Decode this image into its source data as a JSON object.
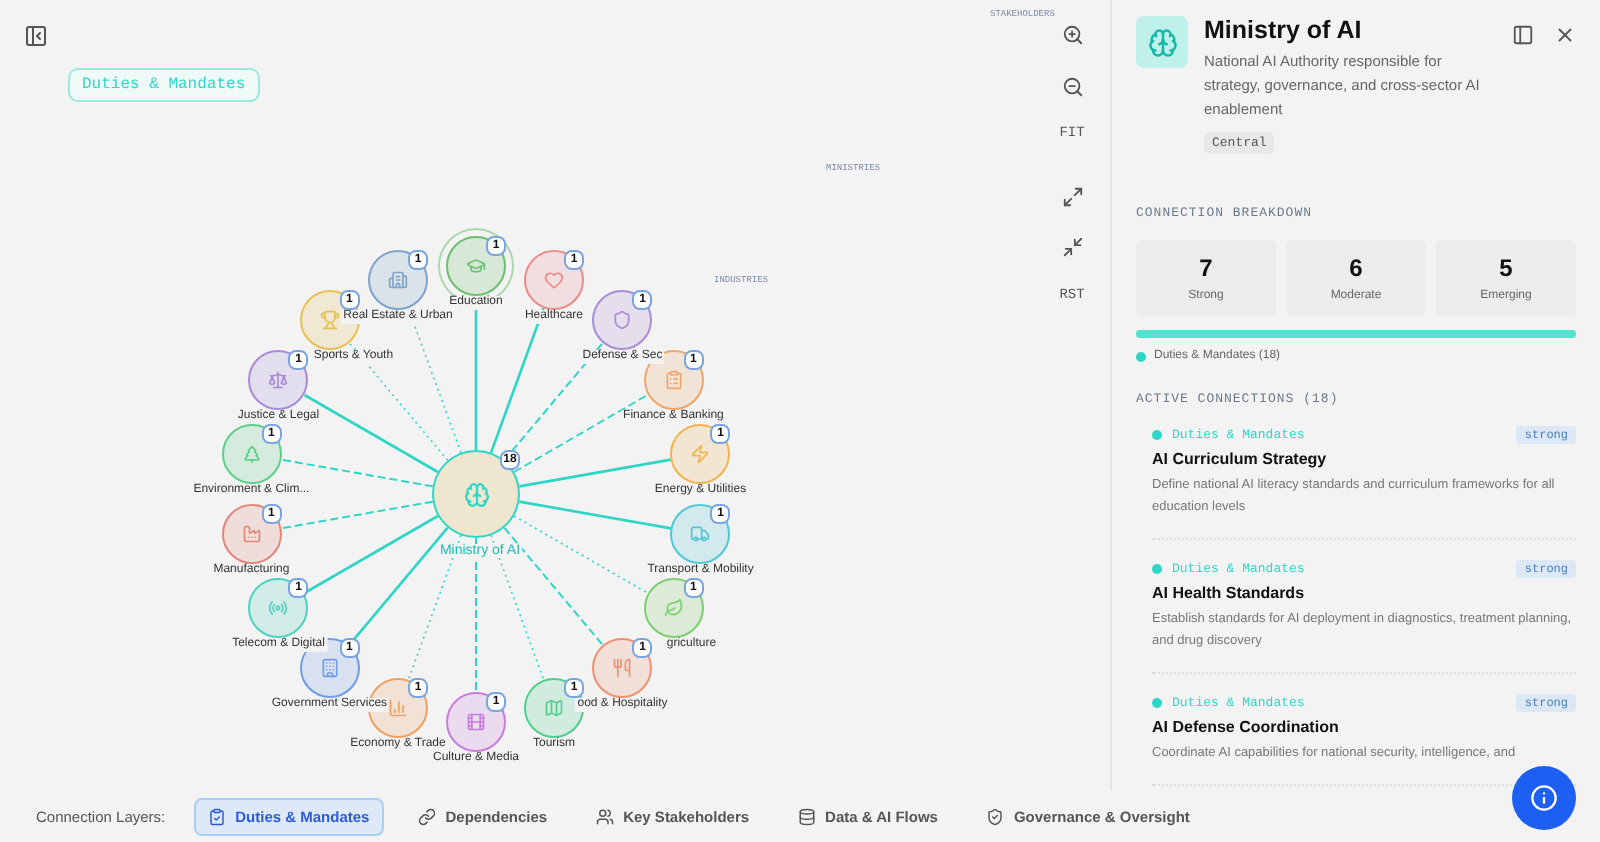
{
  "canvas": {
    "layer_pill": "Duties & Mandates",
    "cluster_labels": [
      "STAKEHOLDERS",
      "MINISTRIES",
      "INDUSTRIES"
    ],
    "controls": [
      {
        "kind": "zoom_in"
      },
      {
        "kind": "zoom_out"
      },
      {
        "kind": "text",
        "label": "FIT"
      },
      {
        "kind": "expand"
      },
      {
        "kind": "shrink"
      },
      {
        "kind": "text",
        "label": "RST"
      }
    ]
  },
  "graph": {
    "center": {
      "label": "Ministry of AI",
      "count": "18"
    },
    "nodes": [
      {
        "label": "Education",
        "count": "1",
        "color": "#6cc070",
        "kind": "strong",
        "hovered": true
      },
      {
        "label": "Real Estate & Urban",
        "count": "1",
        "color": "#7fa3c8",
        "kind": "emerging",
        "hovered": false
      },
      {
        "label": "Healthcare",
        "count": "1",
        "color": "#ec8a8a",
        "kind": "strong",
        "hovered": false
      },
      {
        "label": "Sports & Youth",
        "count": "1",
        "color": "#e8c04f",
        "kind": "emerging",
        "hovered": false
      },
      {
        "label": "Defense & Sec",
        "count": "1",
        "color": "#a98bd6",
        "kind": "moderate",
        "hovered": false
      },
      {
        "label": "Justice & Legal",
        "count": "1",
        "color": "#a78bd8",
        "kind": "strong",
        "hovered": false
      },
      {
        "label": "Finance & Banking",
        "count": "1",
        "color": "#eea66a",
        "kind": "moderate",
        "hovered": false
      },
      {
        "label": "Environment & Clim...",
        "count": "1",
        "color": "#5ccf8a",
        "kind": "moderate",
        "hovered": false
      },
      {
        "label": "Energy & Utilities",
        "count": "1",
        "color": "#f0b450",
        "kind": "strong",
        "hovered": false
      },
      {
        "label": "Manufacturing",
        "count": "1",
        "color": "#e0877a",
        "kind": "moderate",
        "hovered": false
      },
      {
        "label": "Transport & Mobility",
        "count": "1",
        "color": "#4fc7d6",
        "kind": "strong",
        "hovered": false
      },
      {
        "label": "Telecom & Digital",
        "count": "1",
        "color": "#4fd1c0",
        "kind": "strong",
        "hovered": false
      },
      {
        "label": "griculture",
        "count": "1",
        "color": "#7ccf6e",
        "kind": "emerging",
        "hovered": false
      },
      {
        "label": "Government Services",
        "count": "1",
        "color": "#6f9be8",
        "kind": "strong",
        "hovered": false
      },
      {
        "label": "ood & Hospitality",
        "count": "1",
        "color": "#ef8f70",
        "kind": "moderate",
        "hovered": false
      },
      {
        "label": "Economy & Trade",
        "count": "1",
        "color": "#f0a060",
        "kind": "emerging",
        "hovered": false
      },
      {
        "label": "Tourism",
        "count": "1",
        "color": "#4fcf8f",
        "kind": "emerging",
        "hovered": false
      },
      {
        "label": "Culture & Media",
        "count": "1",
        "color": "#c77ddb",
        "kind": "moderate",
        "hovered": false
      }
    ]
  },
  "panel": {
    "title": "Ministry of AI",
    "description": "National AI Authority responsible for strategy, governance, and cross-sector AI enablement",
    "tag": "Central",
    "breakdown_heading": "CONNECTION BREAKDOWN",
    "stats": [
      {
        "value": "7",
        "label": "Strong"
      },
      {
        "value": "6",
        "label": "Moderate"
      },
      {
        "value": "5",
        "label": "Emerging"
      }
    ],
    "bar": {
      "level": 1
    },
    "legend": "Duties & Mandates (18)",
    "connections_heading": "ACTIVE CONNECTIONS (18)",
    "connections": [
      {
        "layer": "Duties & Mandates",
        "strength": "strong",
        "title": "AI Curriculum Strategy",
        "description": "Define national AI literacy standards and curriculum frameworks for all education levels"
      },
      {
        "layer": "Duties & Mandates",
        "strength": "strong",
        "title": "AI Health Standards",
        "description": "Establish standards for AI deployment in diagnostics, treatment planning, and drug discovery"
      },
      {
        "layer": "Duties & Mandates",
        "strength": "strong",
        "title": "AI Defense Coordination",
        "description": "Coordinate AI capabilities for national security, intelligence, and"
      }
    ]
  },
  "layers": {
    "label": "Connection Layers:",
    "tabs": [
      {
        "label": "Duties & Mandates",
        "selected": true
      },
      {
        "label": "Dependencies",
        "selected": false
      },
      {
        "label": "Key Stakeholders",
        "selected": false
      },
      {
        "label": "Data & AI Flows",
        "selected": false
      },
      {
        "label": "Governance & Oversight",
        "selected": false
      }
    ]
  }
}
